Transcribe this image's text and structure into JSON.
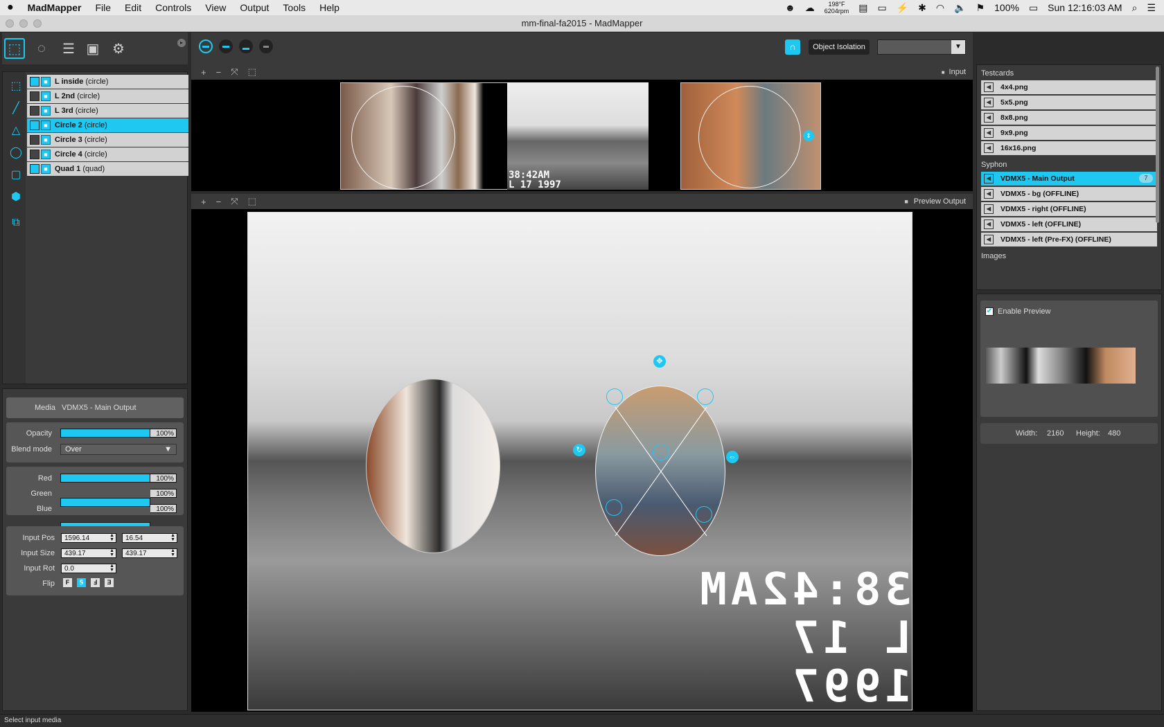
{
  "menubar": {
    "apple": "",
    "app_name": "MadMapper",
    "menus": [
      "File",
      "Edit",
      "Controls",
      "View",
      "Output",
      "Tools",
      "Help"
    ],
    "temp": "198°F",
    "rpm": "6204rpm",
    "battery": "100%",
    "clock": "Sun 12:16:03 AM"
  },
  "window": {
    "title": "mm-final-fa2015 - MadMapper"
  },
  "layers": [
    {
      "name": "L inside",
      "type": "(circle)",
      "checked": true,
      "selected": false
    },
    {
      "name": "L 2nd",
      "type": "(circle)",
      "checked": false,
      "selected": false
    },
    {
      "name": "L 3rd",
      "type": "(circle)",
      "checked": false,
      "selected": false
    },
    {
      "name": "Circle 2",
      "type": "(circle)",
      "checked": true,
      "selected": true
    },
    {
      "name": "Circle 3",
      "type": "(circle)",
      "checked": false,
      "selected": false
    },
    {
      "name": "Circle 4",
      "type": "(circle)",
      "checked": false,
      "selected": false
    },
    {
      "name": "Quad 1",
      "type": "(quad)",
      "checked": true,
      "selected": false
    }
  ],
  "props": {
    "media_label": "Media",
    "media_value": "VDMX5 - Main Output",
    "opacity_label": "Opacity",
    "opacity": "100%",
    "blend_label": "Blend mode",
    "blend_value": "Over",
    "red_label": "Red",
    "red": "100%",
    "green_label": "Green",
    "green": "100%",
    "blue_label": "Blue",
    "blue": "100%",
    "input_pos_label": "Input Pos",
    "input_pos_x": "1596.14",
    "input_pos_y": "16.54",
    "input_size_label": "Input Size",
    "input_size_w": "439.17",
    "input_size_h": "439.17",
    "input_rot_label": "Input Rot",
    "input_rot": "0.0",
    "flip_label": "Flip",
    "flip_buttons": [
      "F",
      "Ꟊ",
      "Ⅎ",
      "Ǝ"
    ]
  },
  "toolbar": {
    "object_isolation": "Object Isolation"
  },
  "input_view": {
    "label": "Input",
    "timestamp1": "38:42AM",
    "timestamp2": "L 17 1997"
  },
  "preview_view": {
    "label": "Preview Output",
    "overlay_time": "38:42AM",
    "overlay_date": "L 17 1997"
  },
  "right": {
    "testcards_header": "Testcards",
    "testcards": [
      "4x4.png",
      "5x5.png",
      "8x8.png",
      "9x9.png",
      "16x16.png"
    ],
    "syphon_header": "Syphon",
    "syphon": [
      {
        "name": "VDMX5 - Main Output",
        "selected": true,
        "badge": "7"
      },
      {
        "name": "VDMX5 - bg (OFFLINE)",
        "selected": false,
        "badge": ""
      },
      {
        "name": "VDMX5 - right (OFFLINE)",
        "selected": false,
        "badge": ""
      },
      {
        "name": "VDMX5 - left (OFFLINE)",
        "selected": false,
        "badge": ""
      },
      {
        "name": "VDMX5 - left (Pre-FX) (OFFLINE)",
        "selected": false,
        "badge": ""
      }
    ],
    "images_header": "Images",
    "enable_preview": "Enable Preview",
    "width_label": "Width:",
    "width": "2160",
    "height_label": "Height:",
    "height": "480"
  },
  "status": {
    "text": "Select input media"
  },
  "colors": {
    "accent": "#1ec8f0",
    "panel": "#3a3a3a",
    "menubar": "#e9e9e9"
  }
}
